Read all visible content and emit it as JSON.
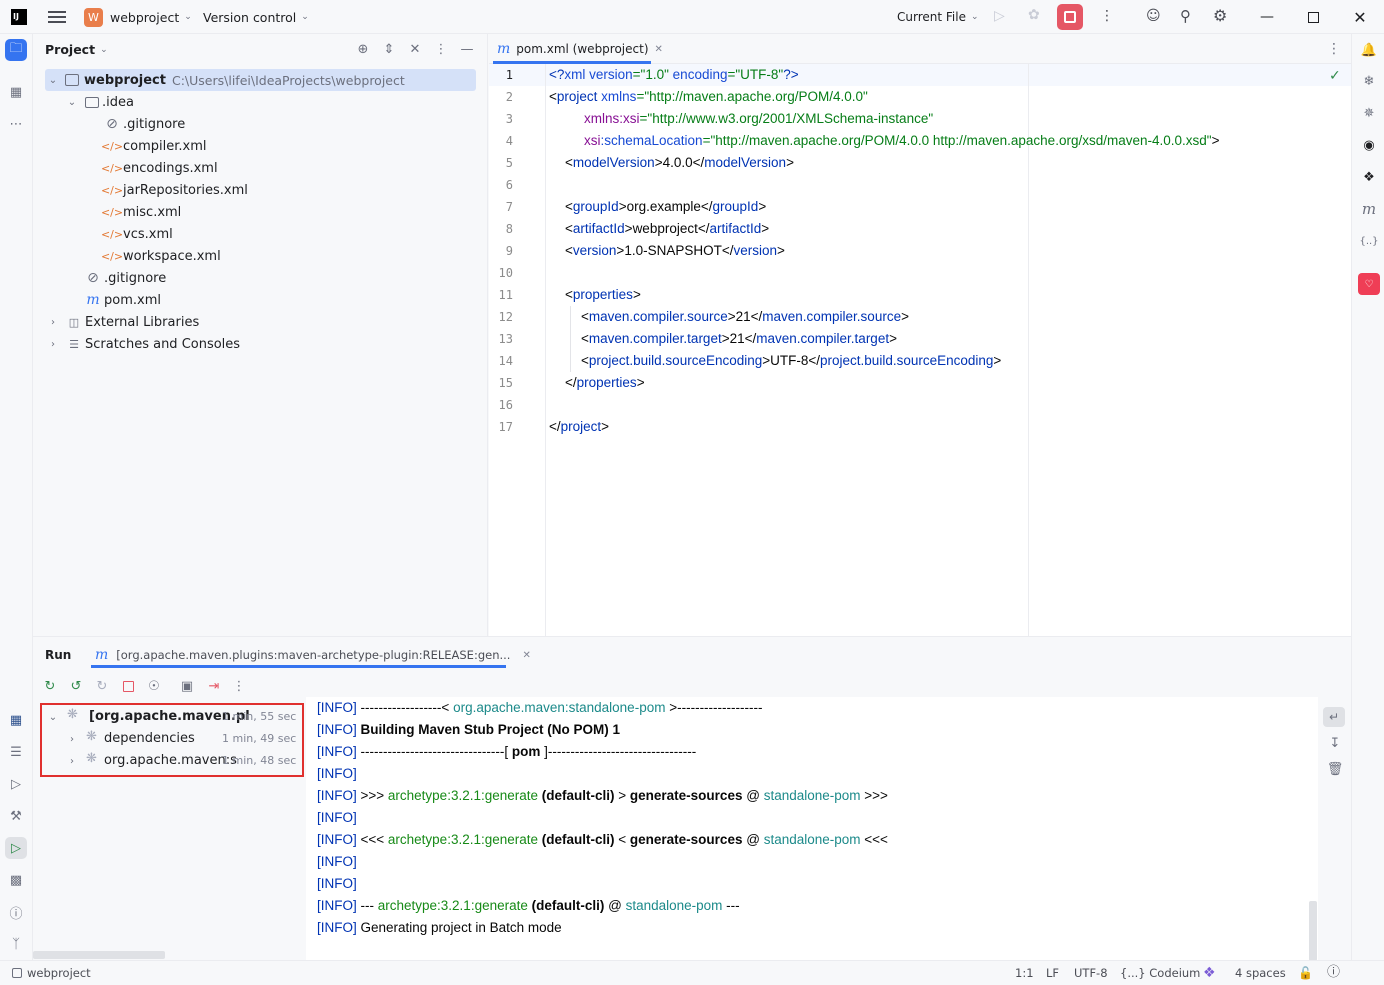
{
  "titlebar": {
    "project_badge": "W",
    "project_name": "webproject",
    "vcs": "Version control",
    "run_config": "Current File"
  },
  "project_panel": {
    "title": "Project",
    "root_name": "webproject",
    "root_path": "C:\\Users\\lifei\\IdeaProjects\\webproject",
    "items": [
      {
        "label": ".idea"
      },
      {
        "label": ".gitignore"
      },
      {
        "label": "compiler.xml"
      },
      {
        "label": "encodings.xml"
      },
      {
        "label": "jarRepositories.xml"
      },
      {
        "label": "misc.xml"
      },
      {
        "label": "vcs.xml"
      },
      {
        "label": "workspace.xml"
      },
      {
        "label": ".gitignore"
      },
      {
        "label": "pom.xml"
      },
      {
        "label": "External Libraries"
      },
      {
        "label": "Scratches and Consoles"
      }
    ]
  },
  "editor": {
    "tab_label": "pom.xml (webproject)",
    "line_numbers": [
      "1",
      "2",
      "3",
      "4",
      "5",
      "6",
      "7",
      "8",
      "9",
      "10",
      "11",
      "12",
      "13",
      "14",
      "15",
      "16",
      "17"
    ]
  },
  "code": {
    "l1": {
      "a": "<?",
      "b": "xml version",
      "c": "=\"1.0\"",
      "d": " encoding",
      "e": "=\"UTF-8\"",
      "f": "?>"
    },
    "l2": {
      "a": "<",
      "b": "project",
      "c": " xmlns",
      "d": "=\"http://maven.apache.org/POM/4.0.0\""
    },
    "l3": {
      "a": "xmlns:xsi",
      "b": "=\"http://www.w3.org/2001/XMLSchema-instance\""
    },
    "l4": {
      "a": "xsi",
      "b": ":schemaLocation",
      "c": "=\"http://maven.apache.org/POM/4.0.0 http://maven.apache.org/xsd/maven-4.0.0.xsd\"",
      "d": ">"
    },
    "l5": {
      "open": "modelVersion",
      "text": "4.0.0",
      "close": "modelVersion"
    },
    "l7": {
      "open": "groupId",
      "text": "org.example",
      "close": "groupId"
    },
    "l8": {
      "open": "artifactId",
      "text": "webproject",
      "close": "artifactId"
    },
    "l9": {
      "open": "version",
      "text": "1.0-SNAPSHOT",
      "close": "version"
    },
    "l11": {
      "open": "properties"
    },
    "l12": {
      "open": "maven.compiler.source",
      "text": "21",
      "close": "maven.compiler.source"
    },
    "l13": {
      "open": "maven.compiler.target",
      "text": "21",
      "close": "maven.compiler.target"
    },
    "l14": {
      "open": "project.build.sourceEncoding",
      "text": "UTF-8",
      "close": "project.build.sourceEncoding"
    },
    "l15": {
      "close": "properties"
    },
    "l17": {
      "close": "project"
    }
  },
  "run_panel": {
    "title": "Run",
    "tab_label": "[org.apache.maven.plugins:maven-archetype-plugin:RELEASE:gen...",
    "tree": [
      {
        "label": "[org.apache.maven.pl",
        "time": "1 min, 55 sec"
      },
      {
        "label": "dependencies",
        "time": "1 min, 49 sec"
      },
      {
        "label": "org.apache.maven:s",
        "time": "1 min, 48 sec"
      }
    ]
  },
  "console": {
    "lines": [
      {
        "tag": "[INFO]",
        "p1": " ------------------< ",
        "p2": "org.apache.maven:standalone-pom",
        "p3": " >-------------------"
      },
      {
        "tag": "[INFO]",
        "p1": " Building Maven Stub Project (No POM) 1"
      },
      {
        "tag": "[INFO]",
        "p1": " --------------------------------[ ",
        "p2": "pom",
        "p3": " ]---------------------------------"
      },
      {
        "tag": "[INFO]"
      },
      {
        "tag": "[INFO]",
        "p1": " >>> ",
        "p2": "archetype:3.2.1:generate",
        "p3": " (default-cli)",
        "p4": " > ",
        "p5": "generate-sources",
        "p6": " @ ",
        "p7": "standalone-pom",
        "p8": " >>>"
      },
      {
        "tag": "[INFO]"
      },
      {
        "tag": "[INFO]",
        "p1": " <<< ",
        "p2": "archetype:3.2.1:generate",
        "p3": " (default-cli)",
        "p4": " < ",
        "p5": "generate-sources",
        "p6": " @ ",
        "p7": "standalone-pom",
        "p8": " <<<"
      },
      {
        "tag": "[INFO]"
      },
      {
        "tag": "[INFO]"
      },
      {
        "tag": "[INFO]",
        "p1": " --- ",
        "p2": "archetype:3.2.1:generate",
        "p3": " (default-cli)",
        "p4": " @ ",
        "p5": "standalone-pom",
        "p6": " ---"
      },
      {
        "tag": "[INFO]",
        "p1": " Generating project in Batch mode"
      }
    ]
  },
  "statusbar": {
    "project": "webproject",
    "position": "1:1",
    "line_sep": "LF",
    "encoding": "UTF-8",
    "codeium": "{...} Codeium",
    "indent": "4 spaces"
  },
  "colors": {
    "accent": "#3574f0",
    "stop_button": "#e55765",
    "highlight_box": "#e0302e"
  }
}
